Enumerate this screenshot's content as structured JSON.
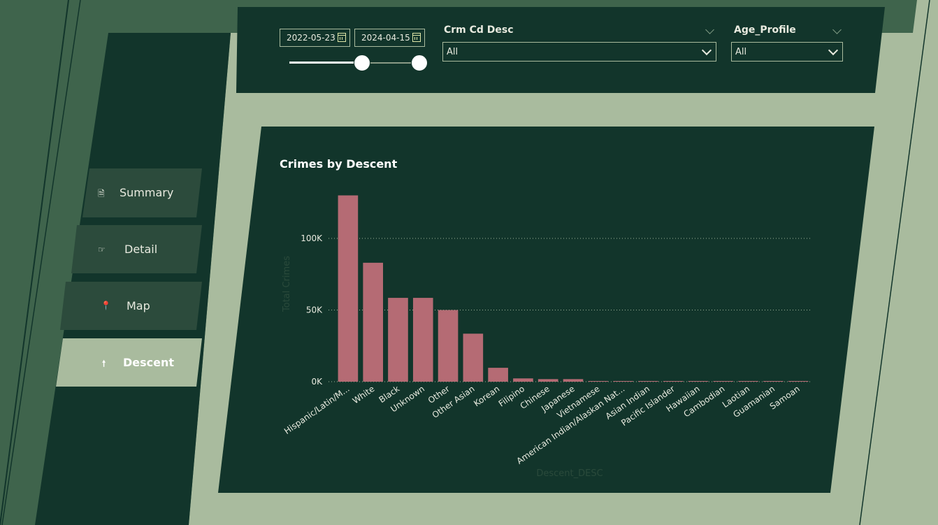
{
  "filters": {
    "date_start": "2022-05-23",
    "date_end": "2024-04-15",
    "crm_title": "Crm Cd Desc",
    "crm_value": "All",
    "age_title": "Age_Profile",
    "age_value": "All"
  },
  "nav": {
    "items": [
      {
        "label": "Summary",
        "icon": "document-icon"
      },
      {
        "label": "Detail",
        "icon": "hand-pointer-icon"
      },
      {
        "label": "Map",
        "icon": "pin-icon"
      },
      {
        "label": "Descent",
        "icon": "arrow-up-icon"
      }
    ],
    "active": "Descent"
  },
  "colors": {
    "bar": "#b56b74",
    "panel": "#12352b",
    "background": "#a9bb9e",
    "active_nav": "#a9bb9e"
  },
  "chart_data": {
    "type": "bar",
    "title": "Crimes by Descent",
    "xlabel": "Descent_DESC",
    "ylabel": "Total Crimes",
    "ylim": [
      0,
      100000
    ],
    "yticks": [
      "0K",
      "50K",
      "100K"
    ],
    "categories": [
      "Hispanic/Latin/M...",
      "White",
      "Black",
      "Unknown",
      "Other",
      "Other Asian",
      "Korean",
      "Filipino",
      "Chinese",
      "Japanese",
      "Vietnamese",
      "American Indian/Alaskan Nat...",
      "Asian Indian",
      "Pacific Islander",
      "Hawaiian",
      "Cambodian",
      "Laotian",
      "Guamanian",
      "Samoan"
    ],
    "values": [
      130000,
      83000,
      58500,
      58500,
      50000,
      33500,
      9700,
      2300,
      1800,
      1800,
      400,
      300,
      250,
      200,
      150,
      100,
      80,
      60,
      50
    ],
    "grid": true
  }
}
